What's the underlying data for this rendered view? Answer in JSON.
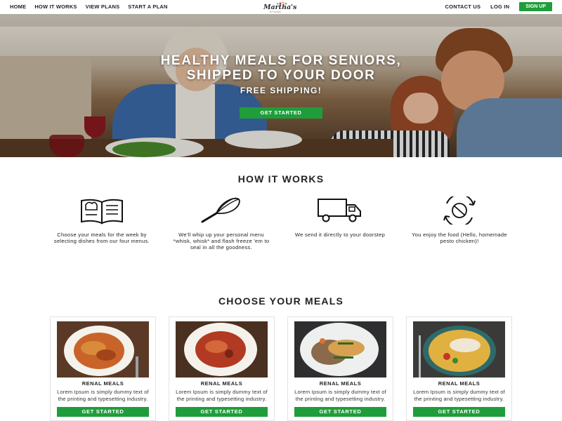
{
  "nav": {
    "links": [
      "HOME",
      "HOW IT WORKS",
      "VIEW PLANS",
      "START A PLAN"
    ],
    "contact": "CONTACT US",
    "login": "LOG IN",
    "signup": "SIGN UP"
  },
  "logo": {
    "name": "Martha's",
    "tagline": "KITCHEN"
  },
  "hero": {
    "title_line1": "HEALTHY MEALS FOR SENIORS,",
    "title_line2": "SHIPPED TO YOUR DOOR",
    "subtitle": "FREE SHIPPING!",
    "cta": "GET STARTED"
  },
  "how_it_works": {
    "title": "HOW IT WORKS",
    "steps": [
      {
        "icon": "menu-book-icon",
        "text": "Choose your meals for the week by selecting dishes from our four menus."
      },
      {
        "icon": "whisk-icon",
        "text": "We'll whip up your personal menu *whisk, whisk* and flash freeze 'em to seal in all the goodness."
      },
      {
        "icon": "delivery-truck-icon",
        "text": "We send it directly to your doorstep"
      },
      {
        "icon": "no-plate-cycle-icon",
        "text": "You enjoy the food (Hello, homemade pesto chicken)!"
      }
    ]
  },
  "meals": {
    "title": "CHOOSE YOUR MEALS",
    "cards": [
      {
        "name": "RENAL MEALS",
        "desc": "Lorem Ipsum is simply dummy text of the printing and typesetting industry.",
        "cta": "GET STARTED"
      },
      {
        "name": "RENAL MEALS",
        "desc": "Lorem Ipsum is simply dummy text of the printing and typesetting industry.",
        "cta": "GET STARTED"
      },
      {
        "name": "RENAL MEALS",
        "desc": "Lorem Ipsum is simply dummy text of the printing and typesetting industry.",
        "cta": "GET STARTED"
      },
      {
        "name": "RENAL MEALS",
        "desc": "Lorem Ipsum is simply dummy text of the printing and typesetting industry.",
        "cta": "GET STARTED"
      }
    ]
  },
  "colors": {
    "accent": "#1f9d3a",
    "text": "#222222"
  }
}
